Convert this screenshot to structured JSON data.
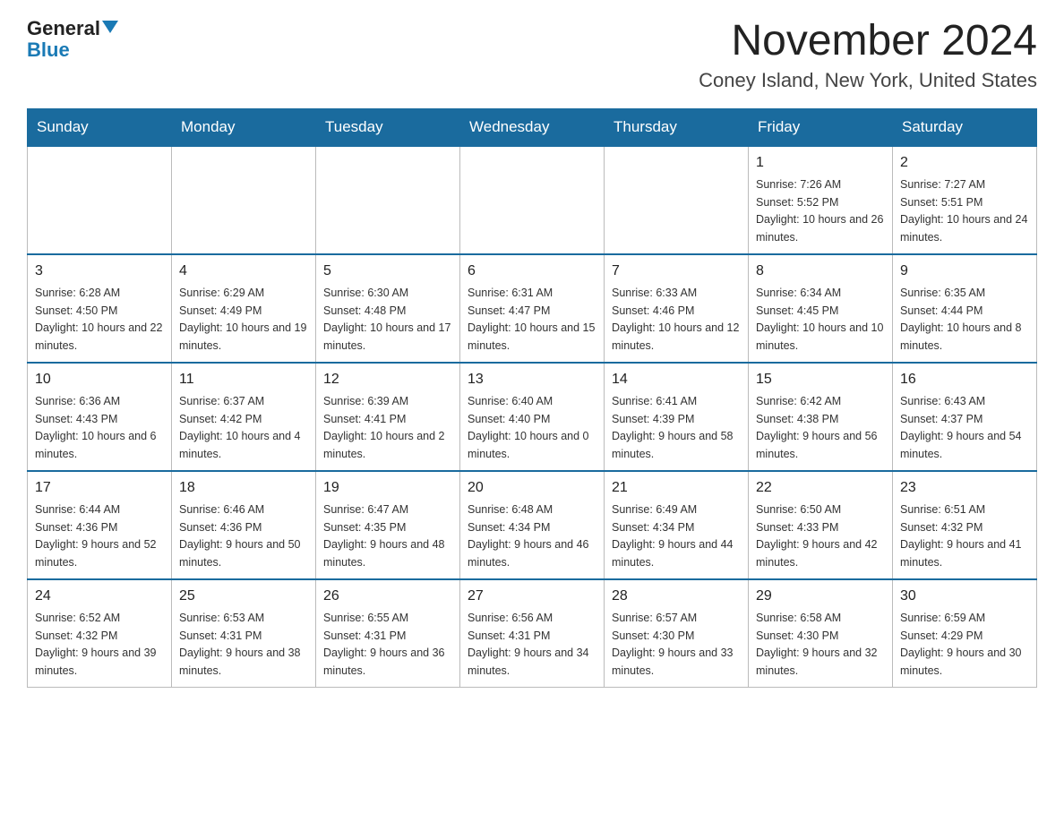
{
  "logo": {
    "general": "General",
    "blue": "Blue"
  },
  "title": "November 2024",
  "subtitle": "Coney Island, New York, United States",
  "days_of_week": [
    "Sunday",
    "Monday",
    "Tuesday",
    "Wednesday",
    "Thursday",
    "Friday",
    "Saturday"
  ],
  "weeks": [
    [
      {
        "day": "",
        "info": ""
      },
      {
        "day": "",
        "info": ""
      },
      {
        "day": "",
        "info": ""
      },
      {
        "day": "",
        "info": ""
      },
      {
        "day": "",
        "info": ""
      },
      {
        "day": "1",
        "info": "Sunrise: 7:26 AM\nSunset: 5:52 PM\nDaylight: 10 hours and 26 minutes."
      },
      {
        "day": "2",
        "info": "Sunrise: 7:27 AM\nSunset: 5:51 PM\nDaylight: 10 hours and 24 minutes."
      }
    ],
    [
      {
        "day": "3",
        "info": "Sunrise: 6:28 AM\nSunset: 4:50 PM\nDaylight: 10 hours and 22 minutes."
      },
      {
        "day": "4",
        "info": "Sunrise: 6:29 AM\nSunset: 4:49 PM\nDaylight: 10 hours and 19 minutes."
      },
      {
        "day": "5",
        "info": "Sunrise: 6:30 AM\nSunset: 4:48 PM\nDaylight: 10 hours and 17 minutes."
      },
      {
        "day": "6",
        "info": "Sunrise: 6:31 AM\nSunset: 4:47 PM\nDaylight: 10 hours and 15 minutes."
      },
      {
        "day": "7",
        "info": "Sunrise: 6:33 AM\nSunset: 4:46 PM\nDaylight: 10 hours and 12 minutes."
      },
      {
        "day": "8",
        "info": "Sunrise: 6:34 AM\nSunset: 4:45 PM\nDaylight: 10 hours and 10 minutes."
      },
      {
        "day": "9",
        "info": "Sunrise: 6:35 AM\nSunset: 4:44 PM\nDaylight: 10 hours and 8 minutes."
      }
    ],
    [
      {
        "day": "10",
        "info": "Sunrise: 6:36 AM\nSunset: 4:43 PM\nDaylight: 10 hours and 6 minutes."
      },
      {
        "day": "11",
        "info": "Sunrise: 6:37 AM\nSunset: 4:42 PM\nDaylight: 10 hours and 4 minutes."
      },
      {
        "day": "12",
        "info": "Sunrise: 6:39 AM\nSunset: 4:41 PM\nDaylight: 10 hours and 2 minutes."
      },
      {
        "day": "13",
        "info": "Sunrise: 6:40 AM\nSunset: 4:40 PM\nDaylight: 10 hours and 0 minutes."
      },
      {
        "day": "14",
        "info": "Sunrise: 6:41 AM\nSunset: 4:39 PM\nDaylight: 9 hours and 58 minutes."
      },
      {
        "day": "15",
        "info": "Sunrise: 6:42 AM\nSunset: 4:38 PM\nDaylight: 9 hours and 56 minutes."
      },
      {
        "day": "16",
        "info": "Sunrise: 6:43 AM\nSunset: 4:37 PM\nDaylight: 9 hours and 54 minutes."
      }
    ],
    [
      {
        "day": "17",
        "info": "Sunrise: 6:44 AM\nSunset: 4:36 PM\nDaylight: 9 hours and 52 minutes."
      },
      {
        "day": "18",
        "info": "Sunrise: 6:46 AM\nSunset: 4:36 PM\nDaylight: 9 hours and 50 minutes."
      },
      {
        "day": "19",
        "info": "Sunrise: 6:47 AM\nSunset: 4:35 PM\nDaylight: 9 hours and 48 minutes."
      },
      {
        "day": "20",
        "info": "Sunrise: 6:48 AM\nSunset: 4:34 PM\nDaylight: 9 hours and 46 minutes."
      },
      {
        "day": "21",
        "info": "Sunrise: 6:49 AM\nSunset: 4:34 PM\nDaylight: 9 hours and 44 minutes."
      },
      {
        "day": "22",
        "info": "Sunrise: 6:50 AM\nSunset: 4:33 PM\nDaylight: 9 hours and 42 minutes."
      },
      {
        "day": "23",
        "info": "Sunrise: 6:51 AM\nSunset: 4:32 PM\nDaylight: 9 hours and 41 minutes."
      }
    ],
    [
      {
        "day": "24",
        "info": "Sunrise: 6:52 AM\nSunset: 4:32 PM\nDaylight: 9 hours and 39 minutes."
      },
      {
        "day": "25",
        "info": "Sunrise: 6:53 AM\nSunset: 4:31 PM\nDaylight: 9 hours and 38 minutes."
      },
      {
        "day": "26",
        "info": "Sunrise: 6:55 AM\nSunset: 4:31 PM\nDaylight: 9 hours and 36 minutes."
      },
      {
        "day": "27",
        "info": "Sunrise: 6:56 AM\nSunset: 4:31 PM\nDaylight: 9 hours and 34 minutes."
      },
      {
        "day": "28",
        "info": "Sunrise: 6:57 AM\nSunset: 4:30 PM\nDaylight: 9 hours and 33 minutes."
      },
      {
        "day": "29",
        "info": "Sunrise: 6:58 AM\nSunset: 4:30 PM\nDaylight: 9 hours and 32 minutes."
      },
      {
        "day": "30",
        "info": "Sunrise: 6:59 AM\nSunset: 4:29 PM\nDaylight: 9 hours and 30 minutes."
      }
    ]
  ]
}
